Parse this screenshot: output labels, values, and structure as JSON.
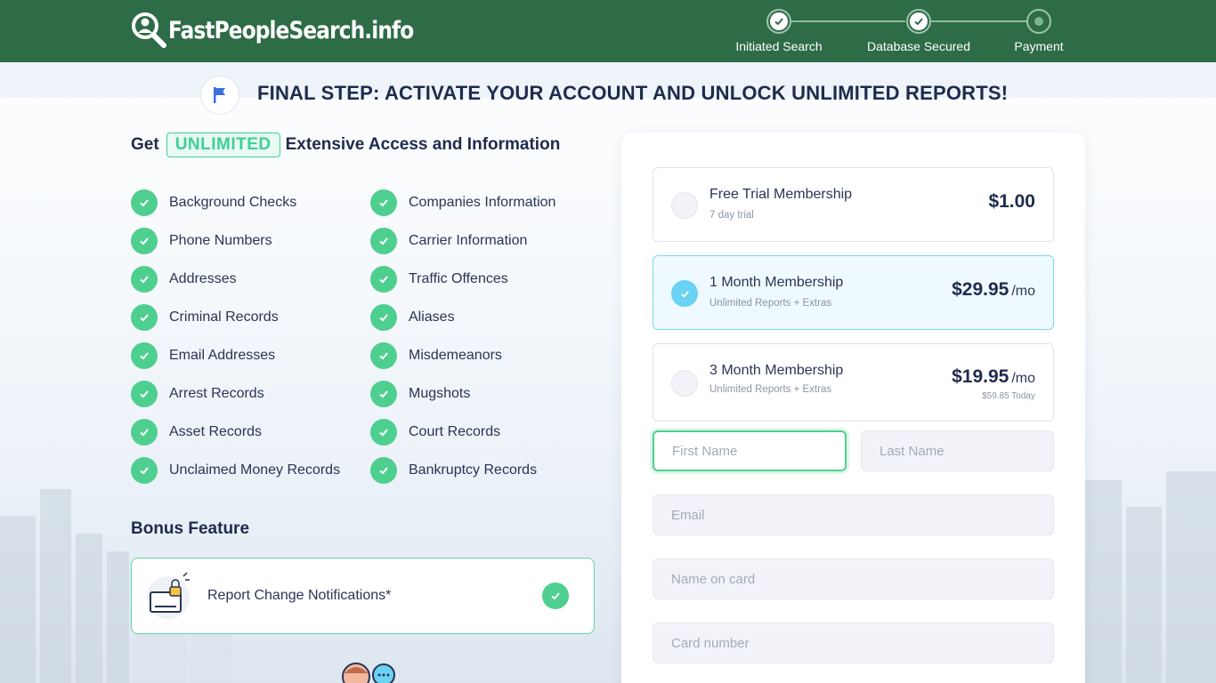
{
  "header": {
    "logo_text": "FastPeopleSearch.info",
    "steps": [
      {
        "label": "Initiated Search",
        "state": "done"
      },
      {
        "label": "Database Secured",
        "state": "done"
      },
      {
        "label": "Payment",
        "state": "current"
      }
    ]
  },
  "banner": {
    "title": "FINAL STEP: ACTIVATE YOUR ACCOUNT AND UNLOCK UNLIMITED REPORTS!"
  },
  "access": {
    "heading_prefix": "Get",
    "badge": "UNLIMITED",
    "heading_suffix": "Extensive Access and Information",
    "features_left": [
      "Background Checks",
      "Phone Numbers",
      "Addresses",
      "Criminal Records",
      "Email Addresses",
      "Arrest Records",
      "Asset Records",
      "Unclaimed Money Records"
    ],
    "features_right": [
      "Companies Information",
      "Carrier Information",
      "Traffic Offences",
      "Aliases",
      "Misdemeanors",
      "Mugshots",
      "Court Records",
      "Bankruptcy Records"
    ]
  },
  "bonus": {
    "heading": "Bonus Feature",
    "label": "Report Change Notifications*"
  },
  "plans": [
    {
      "name": "Free Trial Membership",
      "sub": "7 day trial",
      "price": "$1.00",
      "unit": "",
      "today": "",
      "selected": false
    },
    {
      "name": "1 Month Membership",
      "sub": "Unlimited Reports + Extras",
      "price": "$29.95",
      "unit": "/mo",
      "today": "",
      "selected": true
    },
    {
      "name": "3 Month Membership",
      "sub": "Unlimited Reports + Extras",
      "price": "$19.95",
      "unit": "/mo",
      "today": "$59.85 Today",
      "selected": false
    }
  ],
  "form": {
    "first_name": {
      "placeholder": "First Name",
      "value": ""
    },
    "last_name": {
      "placeholder": "Last Name",
      "value": ""
    },
    "email": {
      "placeholder": "Email",
      "value": ""
    },
    "name_on_card": {
      "placeholder": "Name on card",
      "value": ""
    },
    "card_number": {
      "placeholder": "Card number",
      "value": ""
    }
  },
  "colors": {
    "header_green": "#2e6b47",
    "accent_green": "#4fcf8f",
    "selected_blue": "#6ad2f2",
    "text_navy": "#1f2b4d"
  }
}
